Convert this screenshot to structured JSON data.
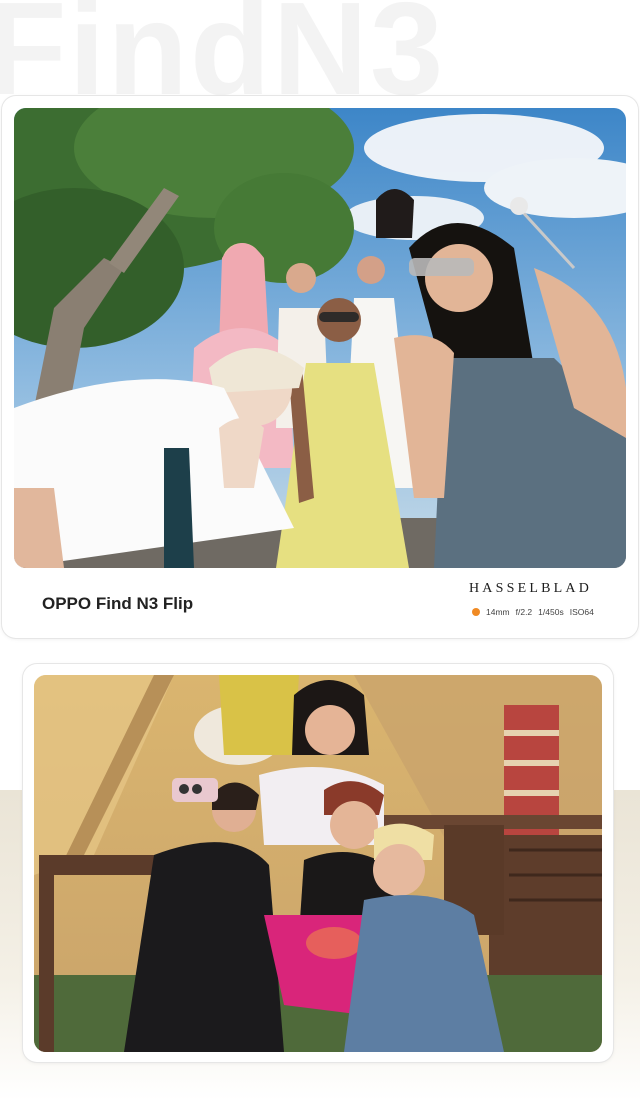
{
  "background": {
    "wordmark": "FindN3"
  },
  "gallery": {
    "card_1": {
      "photo_alt": "Group of eight young people posing outdoors under a tree and blue sky",
      "device_label": "OPPO Find N3 Flip",
      "brand_mark": "HASSELBLAD",
      "exif": {
        "focal": "14mm",
        "aperture": "f/2.2",
        "shutter": "1/450s",
        "iso": "ISO64"
      }
    },
    "card_2": {
      "photo_alt": "Four women taking a selfie with a flip phone at a garden party table"
    }
  },
  "colors": {
    "exif_dot": "#f08a24",
    "gold_band": "#eae4d6"
  }
}
